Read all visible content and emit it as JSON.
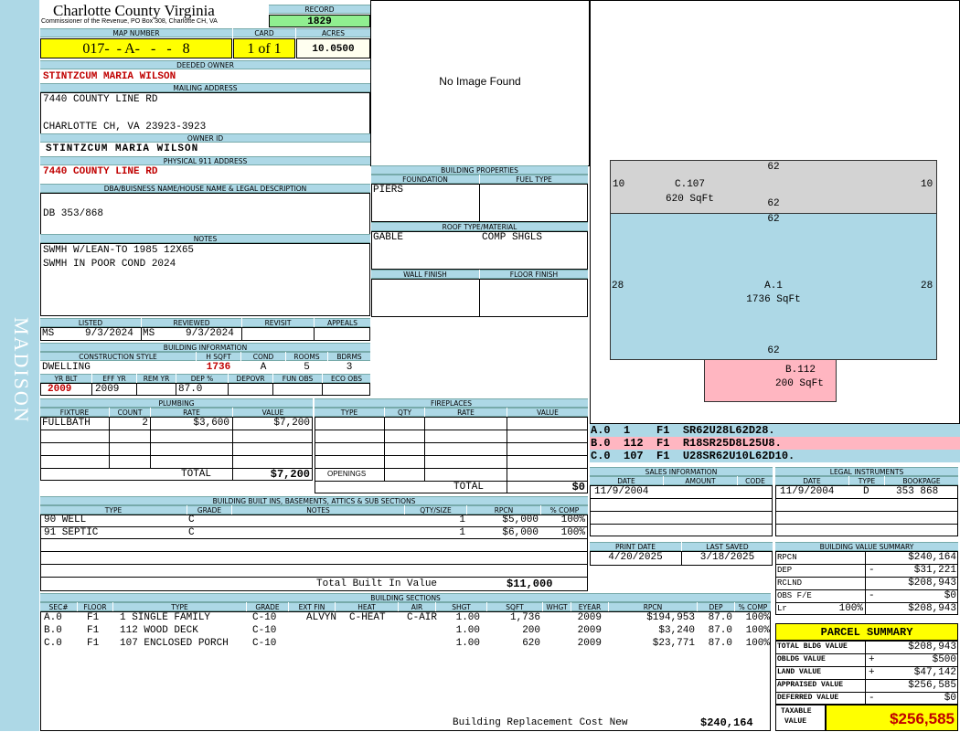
{
  "county": {
    "name": "Charlotte County Virginia",
    "address": "Commissioner of the Revenue, PO Box 308, Charlotte CH, VA",
    "district": "MADISON"
  },
  "record": {
    "label": "RECORD",
    "value": "1829"
  },
  "map": {
    "label": "MAP NUMBER",
    "value": "017-  - A-   -   -   8"
  },
  "card": {
    "label": "CARD",
    "value": "1 of 1"
  },
  "acres": {
    "label": "ACRES",
    "value": "10.0500"
  },
  "owner": {
    "deeded_label": "DEEDED OWNER",
    "deeded": "STINTZCUM MARIA WILSON",
    "mailing_label": "MAILING ADDRESS",
    "mail1": "7440 COUNTY LINE RD",
    "mail2": "CHARLOTTE CH, VA 23923-3923",
    "id_label": "OWNER ID",
    "id_value": "STINTZCUM MARIA WILSON",
    "phys_label": "PHYSICAL 911 ADDRESS",
    "phys": "7440 COUNTY LINE RD"
  },
  "legal": {
    "label": "DBA/BUISNESS NAME/HOUSE NAME & LEGAL DESCRIPTION",
    "value": "DB 353/868"
  },
  "notes": {
    "label": "NOTES",
    "line1": "SWMH W/LEAN-TO 1985 12X65",
    "line2": "SWMH IN POOR COND 2024"
  },
  "listing": {
    "listed_label": "LISTED",
    "reviewed_label": "REVIEWED",
    "revisit_label": "REVISIT",
    "appeals_label": "APPEALS",
    "listed_by": "MS",
    "listed_date": "9/3/2024",
    "reviewed_by": "MS",
    "reviewed_date": "9/3/2024"
  },
  "building_info": {
    "label": "BUILDING INFORMATION",
    "h_style": "CONSTRUCTION STYLE",
    "h_hsqft": "H SQFT",
    "h_cond": "COND",
    "h_rooms": "ROOMS",
    "h_bdrms": "BDRMS",
    "style": "DWELLING",
    "hsqft": "1736",
    "cond": "A",
    "rooms": "5",
    "bdrms": "3",
    "h_yrblt": "YR BLT",
    "h_effyr": "EFF YR",
    "h_remyr": "REM YR",
    "h_dep": "DEP %",
    "h_depovr": "DEPOVR",
    "h_funobs": "FUN OBS",
    "h_ecoobs": "ECO OBS",
    "yrblt": "2009",
    "effyr": "2009",
    "dep": "87.0"
  },
  "image": {
    "text": "No Image Found"
  },
  "building_props": {
    "label": "BUILDING PROPERTIES",
    "foundation_label": "FOUNDATION",
    "fuel_label": "FUEL TYPE",
    "foundation": "PIERS",
    "roof_label": "ROOF TYPE/MATERIAL",
    "roof_type": "GABLE",
    "roof_mat": "COMP SHGLS",
    "wall_label": "WALL FINISH",
    "floor_label": "FLOOR FINISH"
  },
  "sketch": {
    "colors": {
      "porch": "#d3d3d3",
      "main": "#add8e6",
      "deck": "#ffb6c1"
    },
    "c_top": "62",
    "c_left": "10",
    "c_right": "10",
    "c_name": "C.107",
    "c_area": "620 SqFt",
    "c_bottom": "62",
    "a_top": "62",
    "a_left": "28",
    "a_right": "28",
    "a_name": "A.1",
    "a_area": "1736 SqFt",
    "a_bottom": "62",
    "b_name": "B.112",
    "b_area": "200 SqFt"
  },
  "sketch_codes": [
    "A.0  1    F1  SR62U28L62D28.",
    "B.0  112  F1  R18SR25D8L25U8.",
    "C.0  107  F1  U28SR62U10L62D10."
  ],
  "plumbing": {
    "label": "PLUMBING",
    "h_fixture": "FIXTURE",
    "h_count": "COUNT",
    "h_rate": "RATE",
    "h_value": "VALUE",
    "fixture": "FULLBATH",
    "count": "2",
    "rate": "$3,600",
    "value": "$7,200",
    "total_label": "TOTAL",
    "total": "$7,200"
  },
  "fireplaces": {
    "label": "FIREPLACES",
    "h_type": "TYPE",
    "h_qty": "QTY",
    "h_rate": "RATE",
    "h_value": "VALUE",
    "openings": "OPENINGS",
    "total_label": "TOTAL",
    "total": "$0"
  },
  "sales": {
    "label": "SALES INFORMATION",
    "h_date": "DATE",
    "h_amount": "AMOUNT",
    "h_code": "CODE",
    "date": "11/9/2004"
  },
  "legal_inst": {
    "label": "LEGAL INSTRUMENTS",
    "h_date": "DATE",
    "h_type": "TYPE",
    "h_bookpage": "BOOKPAGE",
    "date": "11/9/2004",
    "type": "D",
    "bookpage": "353 868"
  },
  "print": {
    "print_label": "PRINT DATE",
    "saved_label": "LAST SAVED",
    "print_date": "4/20/2025",
    "saved_date": "3/18/2025"
  },
  "builtins": {
    "label": "BUILDING BUILT INS, BASEMENTS, ATTICS & SUB SECTIONS",
    "h_type": "TYPE",
    "h_grade": "GRADE",
    "h_notes": "NOTES",
    "h_qty": "QTY/SIZE",
    "h_rpcn": "RPCN",
    "h_comp": "% COMP",
    "rows": [
      {
        "type": "90 WELL",
        "grade": "C",
        "qty": "1",
        "rpcn": "$5,000",
        "comp": "100%"
      },
      {
        "type": "91 SEPTIC",
        "grade": "C",
        "qty": "1",
        "rpcn": "$6,000",
        "comp": "100%"
      }
    ],
    "total_label": "Total Built In Value",
    "total": "$11,000"
  },
  "value_summary": {
    "label": "BUILDING VALUE SUMMARY",
    "rpcn_label": "RPCN",
    "rpcn": "$240,164",
    "dep_label": "DEP",
    "dep_sign": "-",
    "dep": "$31,221",
    "rclnd_label": "RCLND",
    "rclnd": "$208,943",
    "obs_label": "OBS F/E",
    "obs_sign": "-",
    "obs": "$0",
    "lr_label": "Lr",
    "lr_pct": "100%",
    "lr": "$208,943"
  },
  "sections": {
    "label": "BUILDING SECTIONS",
    "h_sec": "SEC#",
    "h_floor": "FLOOR",
    "h_type": "TYPE",
    "h_grade": "GRADE",
    "h_extfin": "EXT FIN",
    "h_heat": "HEAT",
    "h_air": "AIR",
    "h_shgt": "SHGT",
    "h_sqft": "SQFT",
    "h_whgt": "WHGT",
    "h_eyear": "EYEAR",
    "h_rpcn": "RPCN",
    "h_dep": "DEP",
    "h_comp": "% COMP",
    "rows": [
      {
        "sec": "A.0",
        "floor": "F1",
        "type": "1 SINGLE FAMILY",
        "grade": "C-10",
        "extfin": "ALVYN",
        "heat": "C-HEAT",
        "air": "C-AIR",
        "shgt": "1.00",
        "sqft": "1,736",
        "eyear": "2009",
        "rpcn": "$194,953",
        "dep": "87.0",
        "comp": "100%"
      },
      {
        "sec": "B.0",
        "floor": "F1",
        "type": "112 WOOD DECK",
        "grade": "C-10",
        "extfin": "",
        "heat": "",
        "air": "",
        "shgt": "1.00",
        "sqft": "200",
        "eyear": "2009",
        "rpcn": "$3,240",
        "dep": "87.0",
        "comp": "100%"
      },
      {
        "sec": "C.0",
        "floor": "F1",
        "type": "107 ENCLOSED PORCH",
        "grade": "C-10",
        "extfin": "",
        "heat": "",
        "air": "",
        "shgt": "1.00",
        "sqft": "620",
        "eyear": "2009",
        "rpcn": "$23,771",
        "dep": "87.0",
        "comp": "100%"
      }
    ],
    "brcn_label": "Building Replacement Cost New",
    "brcn": "$240,164"
  },
  "parcel": {
    "title": "PARCEL SUMMARY",
    "total_bldg_label": "TOTAL BLDG VALUE",
    "total_bldg": "$208,943",
    "obldg_label": "OBLDG VALUE",
    "obldg_sign": "+",
    "obldg": "$500",
    "land_label": "LAND VALUE",
    "land_sign": "+",
    "land": "$47,142",
    "appraised_label": "APPRAISED VALUE",
    "appraised": "$256,585",
    "deferred_label": "DEFERRED VALUE",
    "deferred_sign": "-",
    "deferred": "$0",
    "taxable_label1": "TAXABLE",
    "taxable_label2": "VALUE",
    "taxable": "$256,585"
  }
}
